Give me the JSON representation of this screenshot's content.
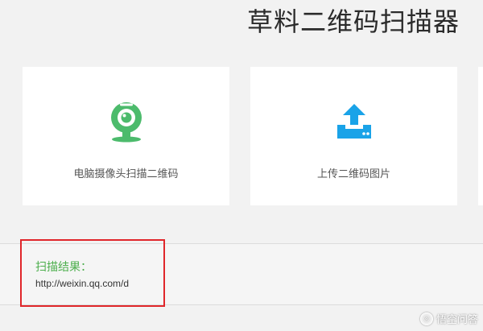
{
  "page": {
    "title": "草料二维码扫描器"
  },
  "cards": {
    "webcam": {
      "label": "电脑摄像头扫描二维码",
      "icon": "webcam-icon",
      "icon_color": "#4cbb6c"
    },
    "upload": {
      "label": "上传二维码图片",
      "icon": "upload-icon",
      "icon_color": "#1aa3e8"
    }
  },
  "result": {
    "label": "扫描结果：",
    "value": "http://weixin.qq.com/d",
    "label_color": "#4cae4c",
    "highlight_color": "#e0262a"
  },
  "watermark": {
    "text": "悟空问答",
    "icon": "wukong-logo-icon"
  }
}
